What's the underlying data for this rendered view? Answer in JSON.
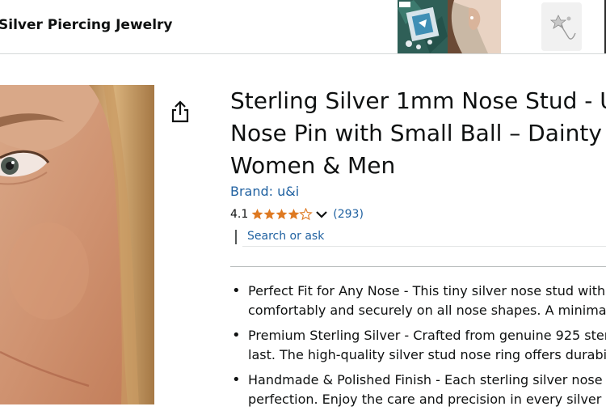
{
  "header": {
    "store_title": "Silver Piercing Jewelry"
  },
  "product": {
    "title": "Sterling Silver 1mm Nose Stud - U\nNose Pin with Small Ball – Dainty N\nWomen & Men",
    "brand": "Brand: u&i",
    "rating": "4.1",
    "stars": 4.1,
    "review_count": "(293)",
    "search_placeholder": "Search or ask"
  },
  "bullets": [
    {
      "text": "Perfect Fit for Any Nose - This tiny silver nose stud with\ncomfortably and securely on all nose shapes. A minimali"
    },
    {
      "text": "Premium Sterling Silver - Crafted from genuine 925 ster\nlast. The high-quality silver stud nose ring offers durabil"
    },
    {
      "text": "Handmade & Polished Finish - Each sterling silver nose s\nperfection. Enjoy the care and precision in every silver n"
    }
  ],
  "colors": {
    "link": "#2162a1",
    "star": "#de7921",
    "text": "#0f1111"
  },
  "icons": {
    "share": "share-icon",
    "chevron": "chevron-down-icon"
  }
}
